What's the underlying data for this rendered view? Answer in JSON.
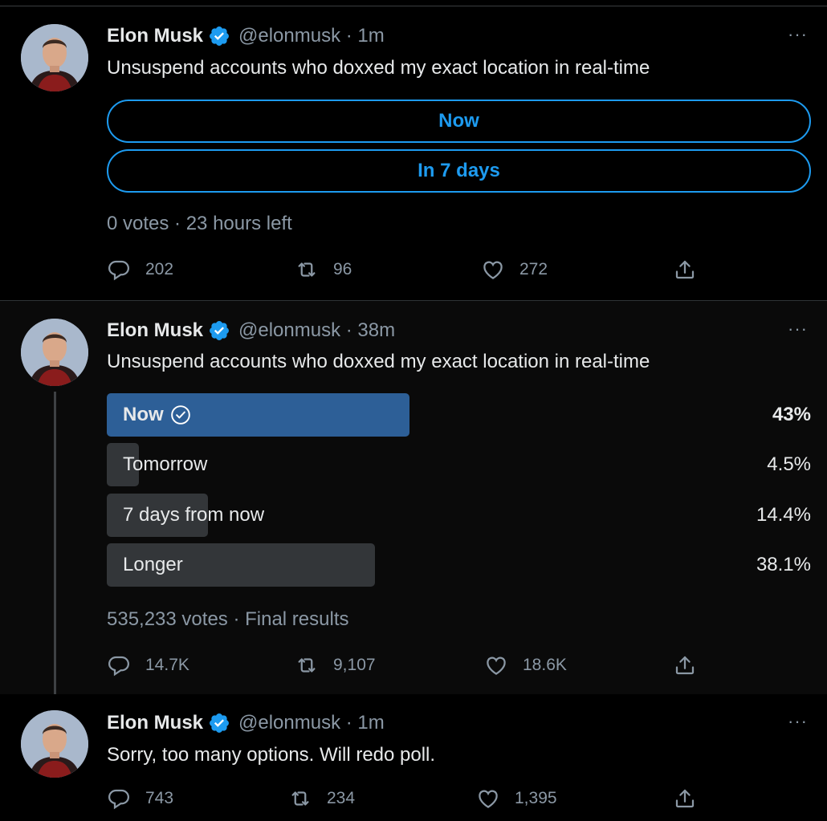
{
  "colors": {
    "accent": "#1d9bf0",
    "winner_bar": "#2d5f97",
    "bar": "#333639",
    "muted": "#8b98a5"
  },
  "icons": [
    "verified-icon",
    "more-icon",
    "reply-icon",
    "retweet-icon",
    "like-icon",
    "share-icon",
    "check-circle-icon"
  ],
  "tweets": [
    {
      "name": "Elon Musk",
      "handle": "@elonmusk · 1m",
      "more": "···",
      "text": "Unsuspend accounts who doxxed my exact location in real-time",
      "poll_options": [
        "Now",
        "In 7 days"
      ],
      "poll_meta": "0 votes · 23 hours left",
      "replies": "202",
      "retweets": "96",
      "likes": "272"
    },
    {
      "name": "Elon Musk",
      "handle": "@elonmusk · 38m",
      "more": "···",
      "text": "Unsuspend accounts who doxxed my exact location in real-time",
      "poll_results": [
        {
          "label": "Now",
          "percent": "43%",
          "fraction": 0.43,
          "winner": true
        },
        {
          "label": "Tomorrow",
          "percent": "4.5%",
          "fraction": 0.045,
          "winner": false
        },
        {
          "label": "7 days from now",
          "percent": "14.4%",
          "fraction": 0.144,
          "winner": false
        },
        {
          "label": "Longer",
          "percent": "38.1%",
          "fraction": 0.381,
          "winner": false
        }
      ],
      "poll_meta": "535,233 votes · Final results",
      "replies": "14.7K",
      "retweets": "9,107",
      "likes": "18.6K"
    },
    {
      "name": "Elon Musk",
      "handle": "@elonmusk · 1m",
      "more": "···",
      "text": "Sorry, too many options. Will redo poll.",
      "replies": "743",
      "retweets": "234",
      "likes": "1,395"
    }
  ]
}
